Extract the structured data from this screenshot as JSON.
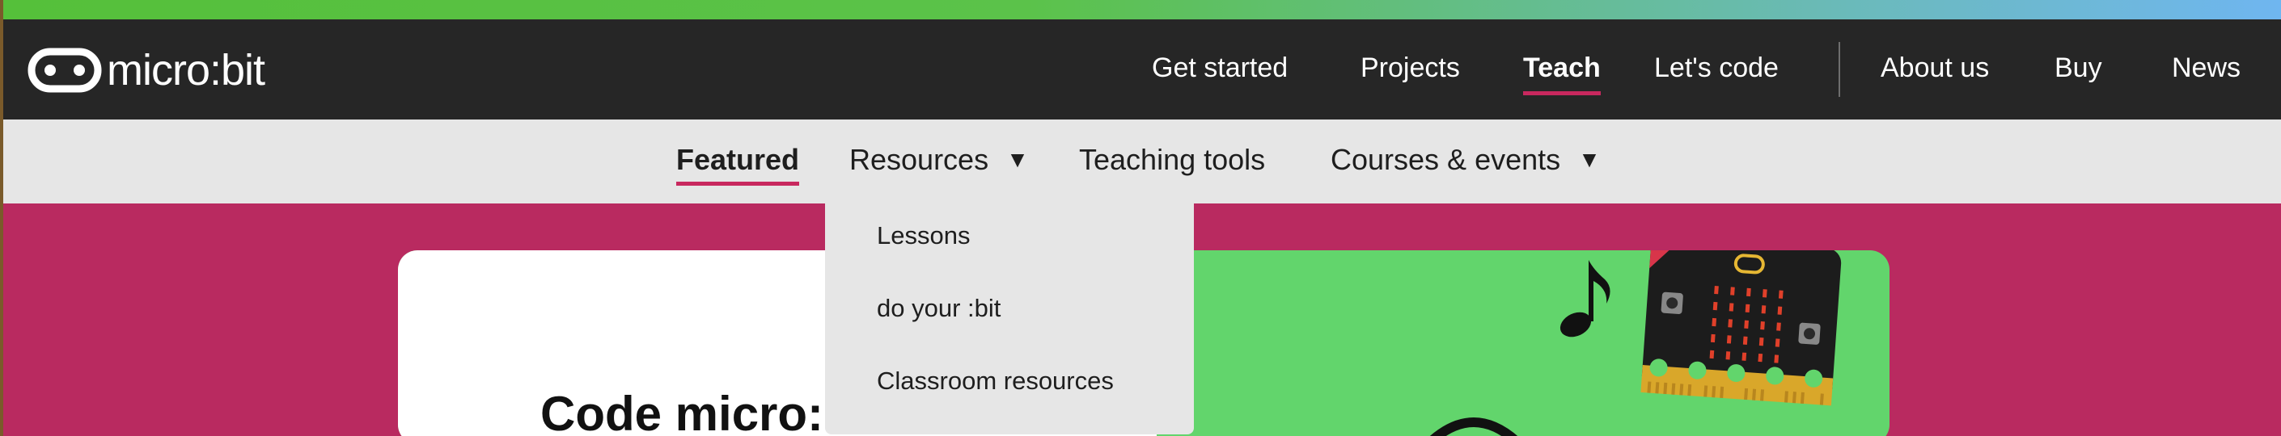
{
  "brand": {
    "logo_text": "micro:bit"
  },
  "main_nav": {
    "items": [
      {
        "label": "Get started"
      },
      {
        "label": "Projects"
      },
      {
        "label": "Teach"
      },
      {
        "label": "Let's code"
      },
      {
        "label": "About us"
      },
      {
        "label": "Buy"
      },
      {
        "label": "News"
      }
    ],
    "active": "Teach"
  },
  "sub_nav": {
    "items": [
      {
        "label": "Featured"
      },
      {
        "label": "Resources",
        "caret": "▼"
      },
      {
        "label": "Teaching tools"
      },
      {
        "label": "Courses & events",
        "caret": "▼"
      }
    ],
    "active": "Featured"
  },
  "resources_dropdown": {
    "items": [
      {
        "label": "Lessons"
      },
      {
        "label": "do your :bit"
      },
      {
        "label": "Classroom resources"
      }
    ]
  },
  "hero": {
    "title": "Code micro:"
  },
  "colors": {
    "accent": "#c8285e",
    "page_background": "#b92a60",
    "nav_background": "#262626",
    "subnav_background": "#e6e6e6",
    "hero_green": "#62d56c"
  },
  "icons": [
    "microbit-logo-icon",
    "caret-down-icon",
    "music-note-icon",
    "microbit-board-illustration"
  ]
}
